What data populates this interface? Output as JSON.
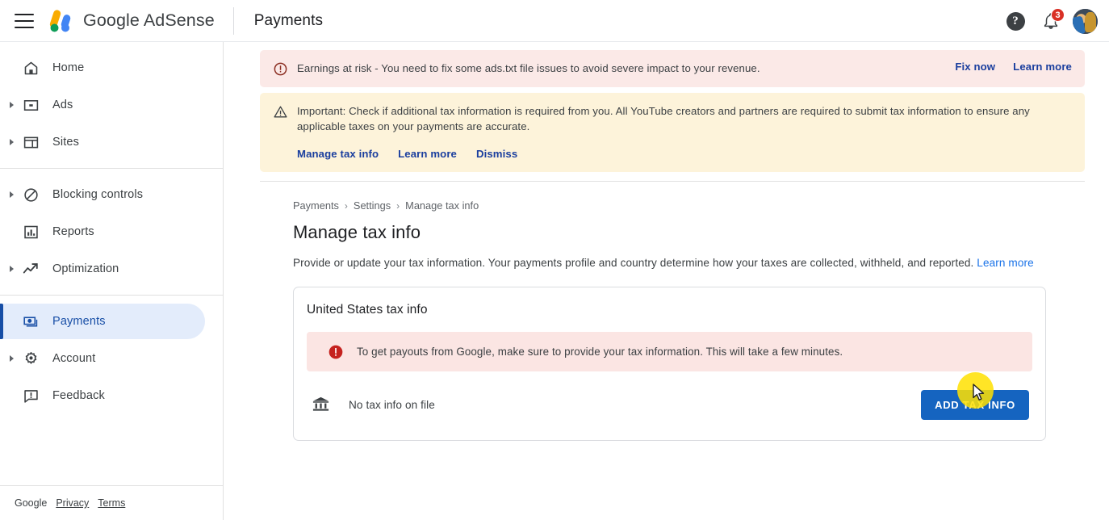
{
  "header": {
    "menu_icon": "hamburger-menu-icon",
    "brand": "Google AdSense",
    "logo_icon": "adsense-logo-icon",
    "page_title": "Payments",
    "help_icon": "help-icon",
    "help_glyph": "?",
    "notifications_icon": "bell-icon",
    "notification_count": "3",
    "avatar_icon": "user-avatar"
  },
  "sidebar": {
    "groups": [
      {
        "items": [
          {
            "label": "Home",
            "icon": "home-icon",
            "expandable": false,
            "active": false
          },
          {
            "label": "Ads",
            "icon": "ads-icon",
            "expandable": true,
            "active": false
          },
          {
            "label": "Sites",
            "icon": "sites-icon",
            "expandable": true,
            "active": false
          }
        ]
      },
      {
        "items": [
          {
            "label": "Blocking controls",
            "icon": "block-icon",
            "expandable": true,
            "active": false
          },
          {
            "label": "Reports",
            "icon": "reports-icon",
            "expandable": false,
            "active": false
          },
          {
            "label": "Optimization",
            "icon": "optimization-icon",
            "expandable": true,
            "active": false
          }
        ]
      },
      {
        "items": [
          {
            "label": "Payments",
            "icon": "payments-icon",
            "expandable": false,
            "active": true
          },
          {
            "label": "Account",
            "icon": "account-gear-icon",
            "expandable": true,
            "active": false
          },
          {
            "label": "Feedback",
            "icon": "feedback-icon",
            "expandable": false,
            "active": false
          }
        ]
      }
    ],
    "footer": {
      "brand": "Google",
      "privacy": "Privacy",
      "terms": "Terms"
    }
  },
  "banners": [
    {
      "type": "error",
      "icon": "error-circle-icon",
      "text": "Earnings at risk - You need to fix some ads.txt file issues to avoid severe impact to your revenue.",
      "links": [
        "Fix now",
        "Learn more"
      ],
      "bg": "#fbe9e7"
    },
    {
      "type": "warning",
      "icon": "warning-triangle-icon",
      "text": "Important: Check if additional tax information is required from you. All YouTube creators and partners are required to submit tax information to ensure any applicable taxes on your payments are accurate.",
      "links": [
        "Manage tax info",
        "Learn more",
        "Dismiss"
      ],
      "bg": "#fdf3da"
    }
  ],
  "main": {
    "breadcrumb": [
      "Payments",
      "Settings",
      "Manage tax info"
    ],
    "breadcrumb_separator": "›",
    "heading": "Manage tax info",
    "description": "Provide or update your tax information. Your payments profile and country determine how your taxes are collected, withheld, and reported.",
    "description_link": "Learn more",
    "card": {
      "title": "United States tax info",
      "alert": {
        "icon": "error-filled-icon",
        "text": "To get payouts from Google, make sure to provide your tax information. This will take a few minutes."
      },
      "status": {
        "icon": "bank-icon",
        "text": "No tax info on file"
      },
      "action_button": "ADD TAX INFO"
    }
  },
  "colors": {
    "accent_blue": "#1564c0",
    "link_blue": "#1a73e8",
    "banner_link_blue": "#1a3e9e",
    "active_nav_blue": "#174ea6",
    "active_nav_bg": "#e3ecfb",
    "error_red": "#d93025",
    "cursor_highlight": "#ffe000"
  }
}
